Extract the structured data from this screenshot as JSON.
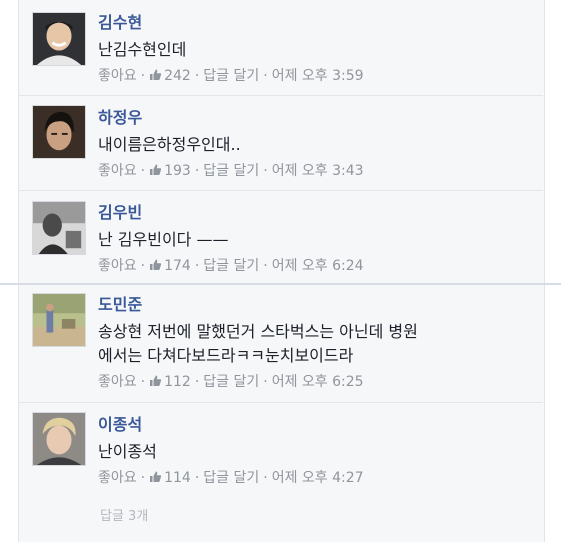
{
  "comments": [
    {
      "name": "김수현",
      "text": "난김수현인데",
      "like_label": "좋아요",
      "likes": "242",
      "reply_label": "답글 달기",
      "time": "어제 오후 3:59"
    },
    {
      "name": "하정우",
      "text": "내이름은하정우인대..",
      "like_label": "좋아요",
      "likes": "193",
      "reply_label": "답글 달기",
      "time": "어제 오후 3:43"
    },
    {
      "name": "김우빈",
      "text": "난 김우빈이다 ——",
      "like_label": "좋아요",
      "likes": "174",
      "reply_label": "답글 달기",
      "time": "어제 오후 6:24"
    },
    {
      "name": "도민준",
      "text": "송상현 저번에 말했던거 스타벅스는 아닌데 병원\n에서는 다쳐다보드라ㅋㅋ눈치보이드라",
      "like_label": "좋아요",
      "likes": "112",
      "reply_label": "답글 달기",
      "time": "어제 오후 6:25"
    },
    {
      "name": "이종석",
      "text": "난이종석",
      "like_label": "좋아요",
      "likes": "114",
      "reply_label": "답글 달기",
      "time": "어제 오후 4:27"
    }
  ],
  "more_replies": "답글 3개",
  "colors": {
    "name": "#3b5998",
    "meta": "#90949c",
    "text": "#1d2129"
  },
  "icons": {
    "like": "thumbs-up-icon"
  }
}
